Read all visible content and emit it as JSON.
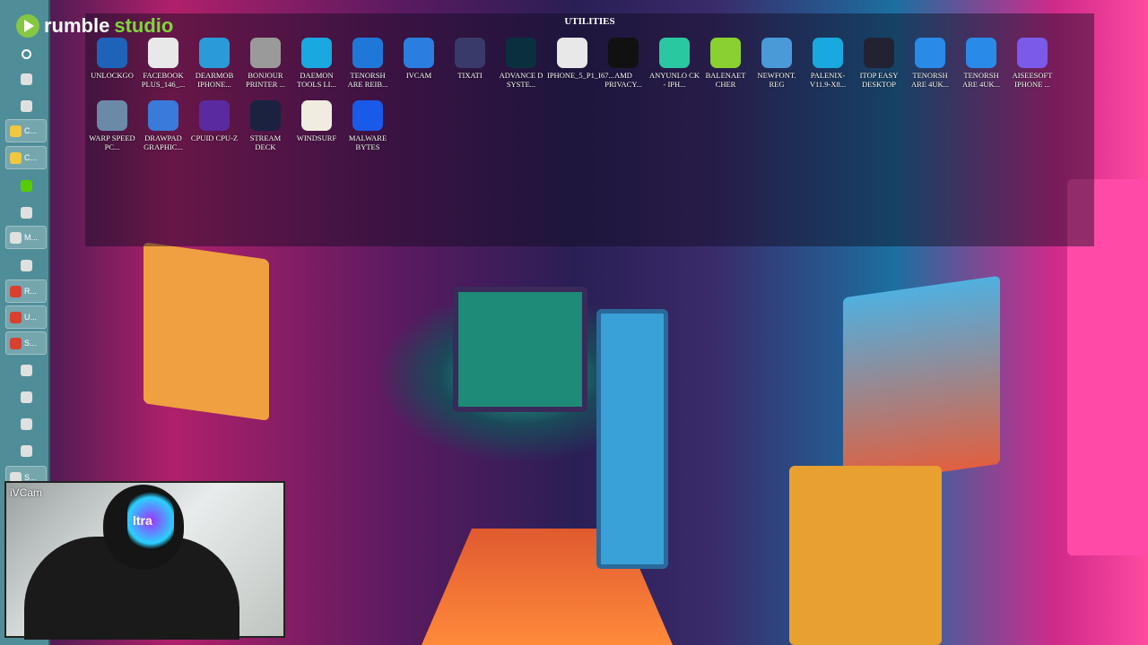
{
  "branding": {
    "name_a": "rumble",
    "name_b": "studio"
  },
  "fence": {
    "title": "UTILITIES",
    "icons": [
      {
        "label": "UNLOCKGO",
        "icon": "share-nodes-icon",
        "color": "#1e63b8"
      },
      {
        "label": "FACEBOOK PLUS_146_...",
        "icon": "ipa-file-icon",
        "color": "#e8e8e8"
      },
      {
        "label": "DEARMOB IPHONE...",
        "icon": "dearmob-icon",
        "color": "#2a9ad8"
      },
      {
        "label": "BONJOUR PRINTER ...",
        "icon": "printer-icon",
        "color": "#9a9a9a"
      },
      {
        "label": "DAEMON TOOLS LI...",
        "icon": "lightning-icon",
        "color": "#1aa8e0"
      },
      {
        "label": "TENORSH ARE REIB...",
        "icon": "tenorshare-r-icon",
        "color": "#1f78d8"
      },
      {
        "label": "IVCAM",
        "icon": "webcam-icon",
        "color": "#2a7ee0"
      },
      {
        "label": "TIXATI",
        "icon": "tixati-icon",
        "color": "#3a3a6a"
      },
      {
        "label": "ADVANCE D SYSTE...",
        "icon": "advanced-systemcare-icon",
        "color": "#0a3040"
      },
      {
        "label": "IPHONE_5_P1_I67...",
        "icon": "ipsw-file-icon",
        "color": "#e8e8e8"
      },
      {
        "label": "AMD PRIVACY...",
        "icon": "eye-shield-icon",
        "color": "#111111"
      },
      {
        "label": "ANYUNLO CK - IPH...",
        "icon": "unlock-icon",
        "color": "#2ac8a0"
      },
      {
        "label": "BALENAET CHER",
        "icon": "cube-icon",
        "color": "#8ad030"
      },
      {
        "label": "NEWFONT. REG",
        "icon": "reg-file-icon",
        "color": "#4a9ad8"
      },
      {
        "label": "PALENIX-V11.9-X8...",
        "icon": "lightning-icon",
        "color": "#1aa8e0"
      },
      {
        "label": "ITOP EASY DESKTOP",
        "icon": "grid-icon",
        "color": "#222233"
      },
      {
        "label": "TENORSH ARE 4UK...",
        "icon": "tenorshare-4uk-icon",
        "color": "#2a8ae8"
      },
      {
        "label": "TENORSH ARE 4UK...",
        "icon": "tenorshare-4uk-icon",
        "color": "#2a8ae8"
      },
      {
        "label": "AISEESOFT IPHONE ...",
        "icon": "lock-icon",
        "color": "#7a5ae8"
      },
      {
        "label": "WARP SPEED PC...",
        "icon": "starburst-icon",
        "color": "#6a8aa8"
      },
      {
        "label": "DRAWPAD GRAPHIC...",
        "icon": "paintbrush-icon",
        "color": "#3a7ad8"
      },
      {
        "label": "CPUID CPU-Z",
        "icon": "chip-icon",
        "color": "#5a2aa0"
      },
      {
        "label": "STREAM DECK",
        "icon": "keypad-icon",
        "color": "#1a2240"
      },
      {
        "label": "WINDSURF",
        "icon": "windsurf-icon",
        "color": "#f0ede0"
      },
      {
        "label": "MALWARE BYTES",
        "icon": "malwarebytes-icon",
        "color": "#1a5ae8"
      }
    ]
  },
  "taskbar": {
    "items": [
      {
        "label": "",
        "icon": "search-icon"
      },
      {
        "label": "",
        "icon": "window-icon"
      },
      {
        "label": "",
        "icon": "app-icon"
      },
      {
        "label": "C...",
        "icon": "folder-icon"
      },
      {
        "label": "C...",
        "icon": "folder-icon"
      },
      {
        "label": "",
        "icon": "duolingo-icon"
      },
      {
        "label": "",
        "icon": "store-icon"
      },
      {
        "label": "M...",
        "icon": "photos-icon"
      },
      {
        "label": "",
        "icon": "capcut-icon"
      },
      {
        "label": "R...",
        "icon": "chrome-icon"
      },
      {
        "label": "U...",
        "icon": "chrome-icon"
      },
      {
        "label": "S...",
        "icon": "chrome-icon"
      },
      {
        "label": "",
        "icon": "app-red-icon"
      },
      {
        "label": "",
        "icon": "record-icon"
      },
      {
        "label": "",
        "icon": "obs-icon"
      },
      {
        "label": "",
        "icon": "ccleaner-icon"
      },
      {
        "label": "S...",
        "icon": "app-icon"
      }
    ]
  },
  "webcam": {
    "label": "iVCam",
    "mask_text": "ltra"
  }
}
